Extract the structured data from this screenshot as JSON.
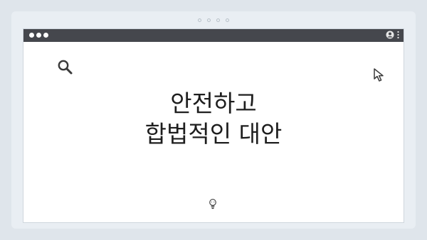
{
  "slide": {
    "title_line1": "안전하고",
    "title_line2": "합법적인 대안"
  },
  "icons": {
    "search": "search-icon",
    "cursor": "cursor-pointer-icon",
    "user": "user-icon",
    "menu": "kebab-menu-icon",
    "bottom": "lightbulb-icon"
  },
  "colors": {
    "background": "#dfe5eb",
    "titlebar": "#45474d",
    "window": "#ffffff",
    "text": "#1e1e1e"
  }
}
